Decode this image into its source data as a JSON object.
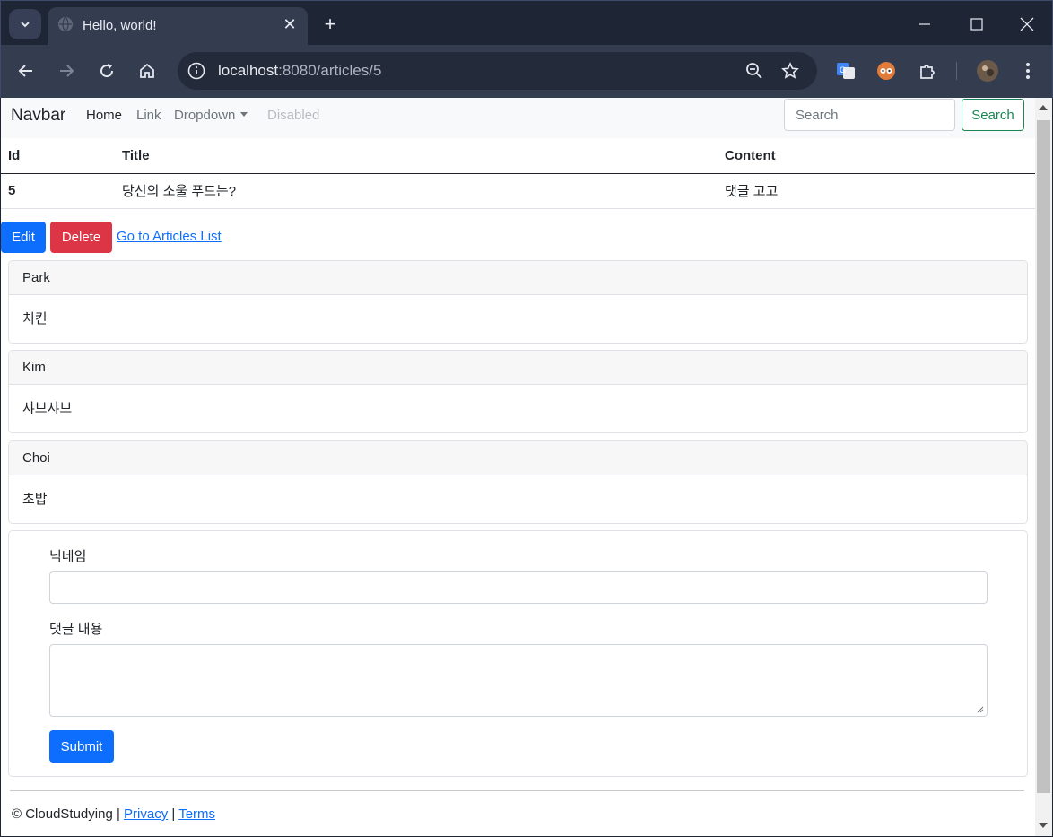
{
  "browser": {
    "tab_title": "Hello, world!",
    "url_host": "localhost",
    "url_path": ":8080/articles/5"
  },
  "navbar": {
    "brand": "Navbar",
    "links": [
      "Home",
      "Link",
      "Dropdown",
      "Disabled"
    ],
    "search_placeholder": "Search",
    "search_button": "Search"
  },
  "article_table": {
    "headers": [
      "Id",
      "Title",
      "Content"
    ],
    "row": {
      "id": "5",
      "title": "당신의 소울 푸드는?",
      "content": "댓글 고고"
    }
  },
  "actions": {
    "edit": "Edit",
    "delete": "Delete",
    "list_link": "Go to Articles List"
  },
  "comments": [
    {
      "nickname": "Park",
      "body": "치킨"
    },
    {
      "nickname": "Kim",
      "body": "샤브샤브"
    },
    {
      "nickname": "Choi",
      "body": "초밥"
    }
  ],
  "comment_form": {
    "nickname_label": "닉네임",
    "nickname_value": "",
    "body_label": "댓글 내용",
    "body_value": "",
    "submit": "Submit"
  },
  "footer": {
    "copyright": "© CloudStudying |",
    "privacy": "Privacy",
    "divider": "|",
    "terms": "Terms"
  }
}
